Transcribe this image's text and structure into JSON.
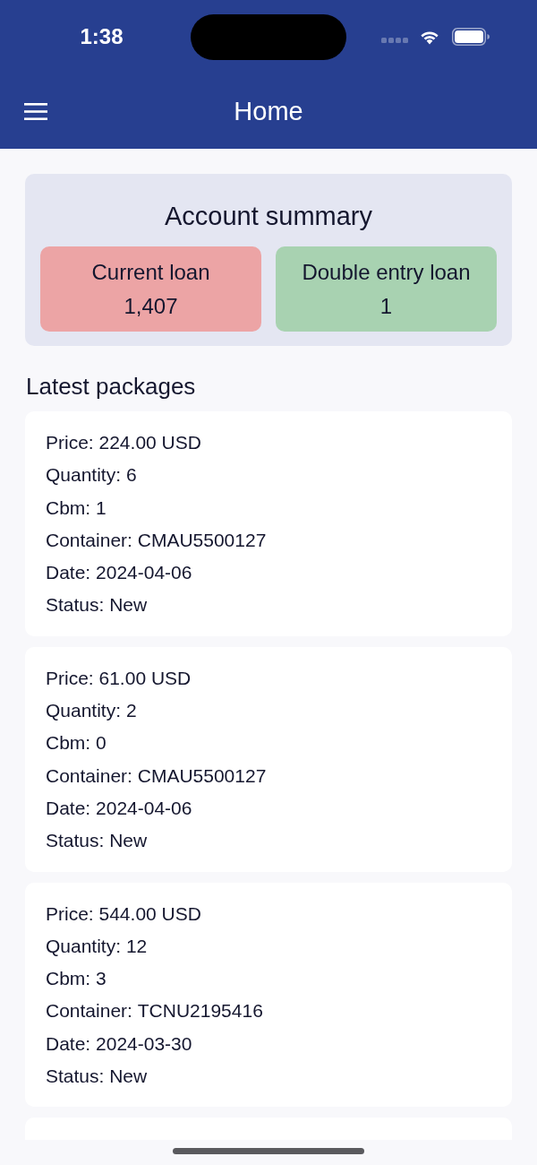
{
  "status_bar": {
    "time": "1:38"
  },
  "header": {
    "title": "Home"
  },
  "account_summary": {
    "title": "Account summary",
    "tiles": [
      {
        "label": "Current loan",
        "value": "1,407",
        "color": "#eca4a5"
      },
      {
        "label": "Double entry loan",
        "value": "1",
        "color": "#a8d2b1"
      }
    ]
  },
  "latest_packages": {
    "title": "Latest packages",
    "packages": [
      {
        "fields": [
          {
            "label": "Price:",
            "value": "224.00 USD"
          },
          {
            "label": "Quantity:",
            "value": "6"
          },
          {
            "label": "Cbm:",
            "value": "1"
          },
          {
            "label": "Container:",
            "value": "CMAU5500127"
          },
          {
            "label": "Date:",
            "value": "2024-04-06"
          },
          {
            "label": "Status:",
            "value": "New"
          }
        ]
      },
      {
        "fields": [
          {
            "label": "Price:",
            "value": "61.00 USD"
          },
          {
            "label": "Quantity:",
            "value": "2"
          },
          {
            "label": "Cbm:",
            "value": "0"
          },
          {
            "label": "Container:",
            "value": "CMAU5500127"
          },
          {
            "label": "Date:",
            "value": "2024-04-06"
          },
          {
            "label": "Status:",
            "value": "New"
          }
        ]
      },
      {
        "fields": [
          {
            "label": "Price:",
            "value": "544.00 USD"
          },
          {
            "label": "Quantity:",
            "value": "12"
          },
          {
            "label": "Cbm:",
            "value": "3"
          },
          {
            "label": "Container:",
            "value": "TCNU2195416"
          },
          {
            "label": "Date:",
            "value": "2024-03-30"
          },
          {
            "label": "Status:",
            "value": "New"
          }
        ]
      }
    ]
  }
}
